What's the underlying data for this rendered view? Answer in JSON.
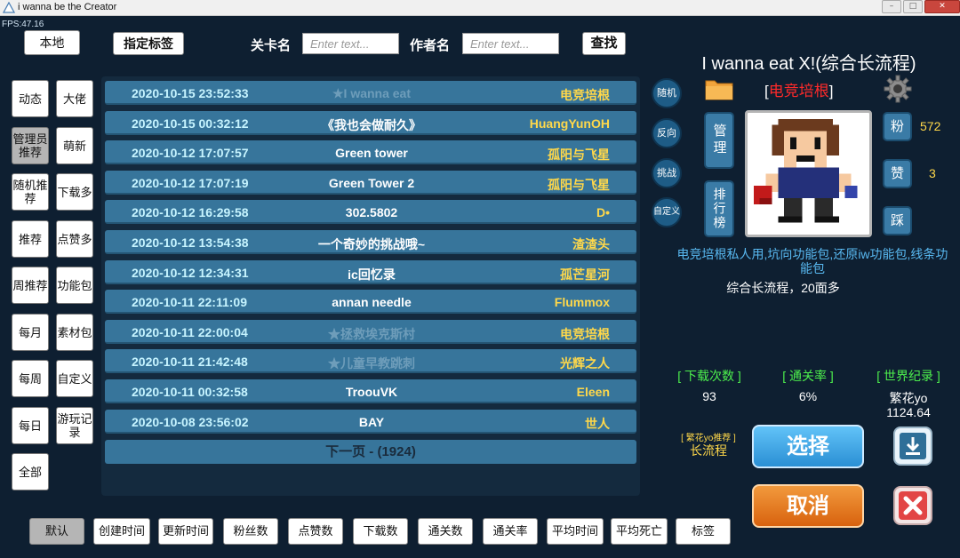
{
  "window": {
    "title": "i wanna be the Creator",
    "fps": "FPS:47.16"
  },
  "top": {
    "local_label": "本地",
    "tags_label": "指定标签",
    "level_name_label": "关卡名",
    "level_name_placeholder": "Enter text...",
    "author_label": "作者名",
    "author_placeholder": "Enter text...",
    "search_label": "查找"
  },
  "sidebar": {
    "items": [
      {
        "label": "动态"
      },
      {
        "label": "大佬"
      },
      {
        "label": "管理员推荐"
      },
      {
        "label": "萌新"
      },
      {
        "label": "随机推荐"
      },
      {
        "label": "下载多"
      },
      {
        "label": "推荐"
      },
      {
        "label": "点赞多"
      },
      {
        "label": "周推荐"
      },
      {
        "label": "功能包"
      },
      {
        "label": "每月"
      },
      {
        "label": "素材包"
      },
      {
        "label": "每周"
      },
      {
        "label": "自定义"
      },
      {
        "label": "每日"
      },
      {
        "label": "游玩记录"
      },
      {
        "label": "全部"
      }
    ]
  },
  "levels": [
    {
      "date": "2020-10-15 23:52:33",
      "name": "★I wanna eat",
      "author": "电竞培根",
      "dim": true
    },
    {
      "date": "2020-10-15 00:32:12",
      "name": "《我也会做耐久》",
      "author": "HuangYunOH",
      "dim": false
    },
    {
      "date": "2020-10-12 17:07:57",
      "name": "Green tower",
      "author": "孤阳与飞星",
      "dim": false
    },
    {
      "date": "2020-10-12 17:07:19",
      "name": "Green Tower 2",
      "author": "孤阳与飞星",
      "dim": false
    },
    {
      "date": "2020-10-12 16:29:58",
      "name": "302.5802",
      "author": "D•",
      "dim": false
    },
    {
      "date": "2020-10-12 13:54:38",
      "name": "一个奇妙的挑战哦~",
      "author": "渣渣头",
      "dim": false
    },
    {
      "date": "2020-10-12 12:34:31",
      "name": "ic回忆录",
      "author": "孤芒星河",
      "dim": false
    },
    {
      "date": "2020-10-11 22:11:09",
      "name": "annan needle",
      "author": "Flummox",
      "dim": false
    },
    {
      "date": "2020-10-11 22:00:04",
      "name": "★拯救埃克斯村",
      "author": "电竞培根",
      "dim": true
    },
    {
      "date": "2020-10-11 21:42:48",
      "name": "★儿童早教跳刺",
      "author": "光辉之人",
      "dim": true
    },
    {
      "date": "2020-10-11 00:32:58",
      "name": "TroouVK",
      "author": "Eleen",
      "dim": false
    },
    {
      "date": "2020-10-08 23:56:02",
      "name": "BAY",
      "author": "世人",
      "dim": false
    }
  ],
  "next_page": "下一页 - (1924)",
  "circles": {
    "random": "随机",
    "reverse": "反向",
    "challenge": "挑战",
    "custom": "自定义"
  },
  "manage_label": "管理",
  "ranking_label": "排行榜",
  "detail": {
    "title": "I wanna eat X!(综合长流程)",
    "author_prefix": "[",
    "author": "电竞培根",
    "author_suffix": "]",
    "fans_label": "粉",
    "fans": "572",
    "likes_label": "赞",
    "likes": "3",
    "dislike_label": "踩",
    "desc_blue": "电竞培根私人用,坑向功能包,还原iw功能包,线条功能包",
    "desc_white": "综合长流程，20面多",
    "downloads_label": "[ 下载次数 ]",
    "downloads": "93",
    "clear_rate_label": "[ 通关率 ]",
    "clear_rate": "6%",
    "record_label": "[ 世界纪录 ]",
    "record_holder": "繁花yo",
    "record_time": "1124.64",
    "rec_label": "[ 繁花yo推荐 ]",
    "rec_value": "长流程",
    "select_label": "选择",
    "cancel_label": "取消"
  },
  "sort": {
    "items": [
      {
        "label": "默认"
      },
      {
        "label": "创建时间"
      },
      {
        "label": "更新时间"
      },
      {
        "label": "粉丝数"
      },
      {
        "label": "点赞数"
      },
      {
        "label": "下载数"
      },
      {
        "label": "通关数"
      },
      {
        "label": "通关率"
      },
      {
        "label": "平均时间"
      },
      {
        "label": "平均死亡"
      },
      {
        "label": "标签"
      }
    ]
  },
  "colors": {
    "background": "#0e1f31",
    "row": "#37759b",
    "author": "#ffd84a",
    "date": "#c6f4ff",
    "stat_head": "#4df04d",
    "select": "#3fa8e6",
    "cancel": "#e0731b"
  }
}
